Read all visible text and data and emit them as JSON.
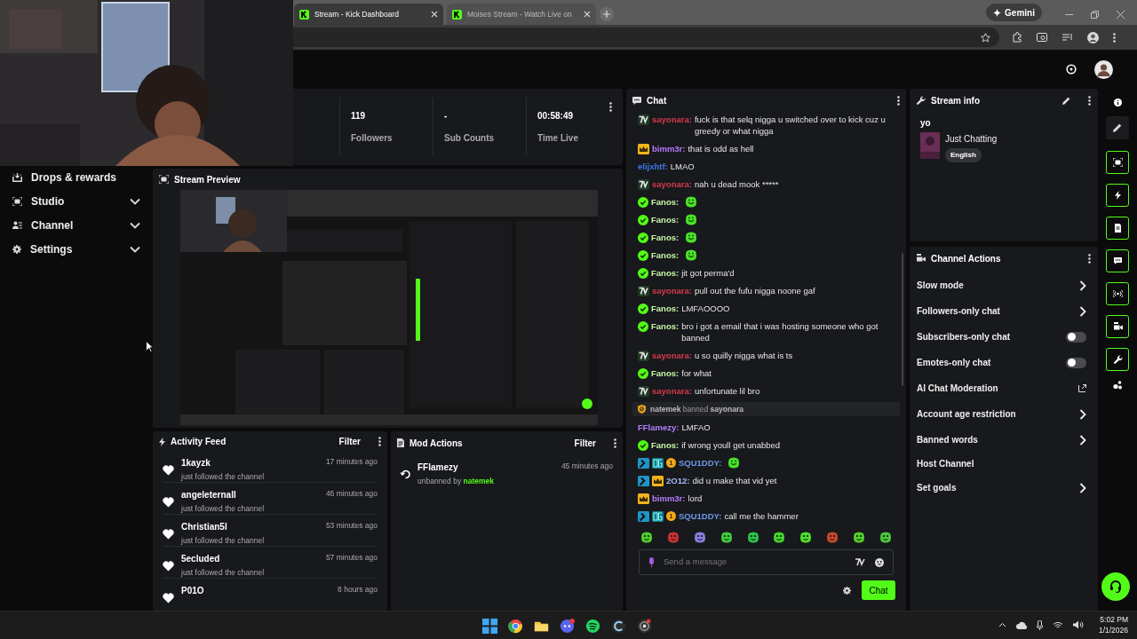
{
  "browser": {
    "tabs": [
      {
        "title": "Stream - Kick Dashboard",
        "selected": true
      },
      {
        "title": "Moises Stream - Watch Live on",
        "selected": false
      }
    ],
    "gemini": "Gemini"
  },
  "sidebar": {
    "items": [
      {
        "label": "Drops & rewards",
        "expandable": false
      },
      {
        "label": "Studio",
        "expandable": true
      },
      {
        "label": "Channel",
        "expandable": true
      },
      {
        "label": "Settings",
        "expandable": true
      }
    ]
  },
  "stats": [
    {
      "value": "119",
      "label": "Followers"
    },
    {
      "value": "-",
      "label": "Sub Counts"
    },
    {
      "value": "00:58:49",
      "label": "Time Live"
    }
  ],
  "stream_preview": {
    "title": "Stream Preview"
  },
  "activity_feed": {
    "title": "Activity Feed",
    "filter": "Filter",
    "items": [
      {
        "user": "1kayzk",
        "detail": "just followed the channel",
        "time": "17 minutes ago"
      },
      {
        "user": "angeleternall",
        "detail": "just followed the channel",
        "time": "46 minutes ago"
      },
      {
        "user": "Christian5l",
        "detail": "just followed the channel",
        "time": "53 minutes ago"
      },
      {
        "user": "5ecluded",
        "detail": "just followed the channel",
        "time": "57 minutes ago"
      },
      {
        "user": "P01O",
        "time": "8 hours ago"
      }
    ]
  },
  "mod_actions": {
    "title": "Mod Actions",
    "filter": "Filter",
    "items": [
      {
        "user": "FFlamezy",
        "action": "unbanned by",
        "actor": "natemek",
        "time": "45 minutes ago"
      }
    ]
  },
  "chat": {
    "title": "Chat",
    "messages": [
      {
        "kind": "message",
        "badges": [
          {
            "kind": "seventv"
          }
        ],
        "user": "sayonara:",
        "color": "#d63a4e",
        "text": "fuck is that selq nigga u switched over to kick cuz u greedy or what nigga",
        "emote": false
      },
      {
        "kind": "message",
        "badges": [
          {
            "kind": "crown"
          }
        ],
        "user": "bimm3r:",
        "color": "#b57cff",
        "text": "that is odd as hell",
        "emote": false
      },
      {
        "kind": "message",
        "user": "elijxhtf:",
        "color": "#3c78e6",
        "text": "LMAO",
        "emote": false
      },
      {
        "kind": "message",
        "badges": [
          {
            "kind": "seventv"
          }
        ],
        "user": "sayonara:",
        "color": "#d63a4e",
        "text": "nah u dead mook *****",
        "emote": false
      },
      {
        "kind": "message",
        "badges": [
          {
            "kind": "verified"
          }
        ],
        "user": "Fanos:",
        "color": "#c8f5a8",
        "emote": true
      },
      {
        "kind": "message",
        "badges": [
          {
            "kind": "verified"
          }
        ],
        "user": "Fanos:",
        "color": "#c8f5a8",
        "emote": true
      },
      {
        "kind": "message",
        "badges": [
          {
            "kind": "verified"
          }
        ],
        "user": "Fanos:",
        "color": "#c8f5a8",
        "emote": true
      },
      {
        "kind": "message",
        "badges": [
          {
            "kind": "verified"
          }
        ],
        "user": "Fanos:",
        "color": "#c8f5a8",
        "emote": true
      },
      {
        "kind": "message",
        "badges": [
          {
            "kind": "verified"
          }
        ],
        "user": "Fanos:",
        "color": "#c8f5a8",
        "text": "jit got perma'd",
        "emote": false
      },
      {
        "kind": "message",
        "badges": [
          {
            "kind": "seventv"
          }
        ],
        "user": "sayonara:",
        "color": "#d63a4e",
        "text": "pull out the fufu nigga noone gaf",
        "emote": false
      },
      {
        "kind": "message",
        "badges": [
          {
            "kind": "verified"
          }
        ],
        "user": "Fanos:",
        "color": "#c8f5a8",
        "text": "LMFAOOOO",
        "emote": false
      },
      {
        "kind": "message",
        "badges": [
          {
            "kind": "verified"
          }
        ],
        "user": "Fanos:",
        "color": "#c8f5a8",
        "text": "bro i got a email that i was hosting someone who got banned",
        "emote": false
      },
      {
        "kind": "message",
        "badges": [
          {
            "kind": "seventv"
          }
        ],
        "user": "sayonara:",
        "color": "#d63a4e",
        "text": "u so quilly nigga what is ts",
        "emote": false
      },
      {
        "kind": "message",
        "badges": [
          {
            "kind": "verified"
          }
        ],
        "user": "Fanos:",
        "color": "#c8f5a8",
        "text": "for what",
        "emote": false
      },
      {
        "kind": "message",
        "badges": [
          {
            "kind": "seventv"
          }
        ],
        "user": "sayonara:",
        "color": "#d63a4e",
        "text": "unfortunate lil bro",
        "emote": false
      },
      {
        "kind": "event",
        "actor": "natemek",
        "action": "banned",
        "target": "sayonara"
      },
      {
        "kind": "message",
        "user": "FFlamezy:",
        "color": "#b57cff",
        "text": "LMFAO",
        "emote": false
      },
      {
        "kind": "message",
        "badges": [
          {
            "kind": "verified"
          }
        ],
        "user": "Fanos:",
        "color": "#c8f5a8",
        "text": "if wrong youll get unabbed",
        "emote": false
      },
      {
        "kind": "message",
        "badges": [
          {
            "kind": "hammer"
          },
          {
            "kind": "og"
          },
          {
            "kind": "coin",
            "text": "1"
          }
        ],
        "user": "SQU1DDY:",
        "color": "#6b98e8",
        "emote": true
      },
      {
        "kind": "message",
        "badges": [
          {
            "kind": "hammer"
          },
          {
            "kind": "crown"
          }
        ],
        "user": "2O12:",
        "color": "#aab9ff",
        "text": "did u make that vid yet",
        "emote": false
      },
      {
        "kind": "message",
        "badges": [
          {
            "kind": "crown"
          }
        ],
        "user": "bimm3r:",
        "color": "#b57cff",
        "text": "lord",
        "emote": false
      },
      {
        "kind": "message",
        "badges": [
          {
            "kind": "hammer"
          },
          {
            "kind": "og"
          },
          {
            "kind": "coin",
            "text": "1"
          }
        ],
        "user": "SQU1DDY:",
        "color": "#6b98e8",
        "text": "call me the hammer",
        "emote": false
      }
    ],
    "input": {
      "placeholder": "Send a message"
    },
    "send_button": "Chat"
  },
  "stream_info": {
    "title": "Stream info",
    "stream_title": "yo",
    "category": "Just Chatting",
    "language": "English"
  },
  "channel_actions": {
    "title": "Channel Actions",
    "items": [
      {
        "label": "Slow mode",
        "kind": "arrow"
      },
      {
        "label": "Followers-only chat",
        "kind": "arrow"
      },
      {
        "label": "Subscribers-only chat",
        "kind": "toggle",
        "on": false
      },
      {
        "label": "Emotes-only chat",
        "kind": "toggle",
        "on": false
      },
      {
        "label": "AI Chat Moderation",
        "kind": "external"
      },
      {
        "label": "Account age restriction",
        "kind": "arrow"
      },
      {
        "label": "Banned words",
        "kind": "arrow"
      },
      {
        "label": "Host Channel",
        "kind": "plain"
      },
      {
        "label": "Set goals",
        "kind": "arrow"
      }
    ]
  },
  "taskbar": {
    "time": "5:02 PM",
    "date": "1/1/2026"
  }
}
